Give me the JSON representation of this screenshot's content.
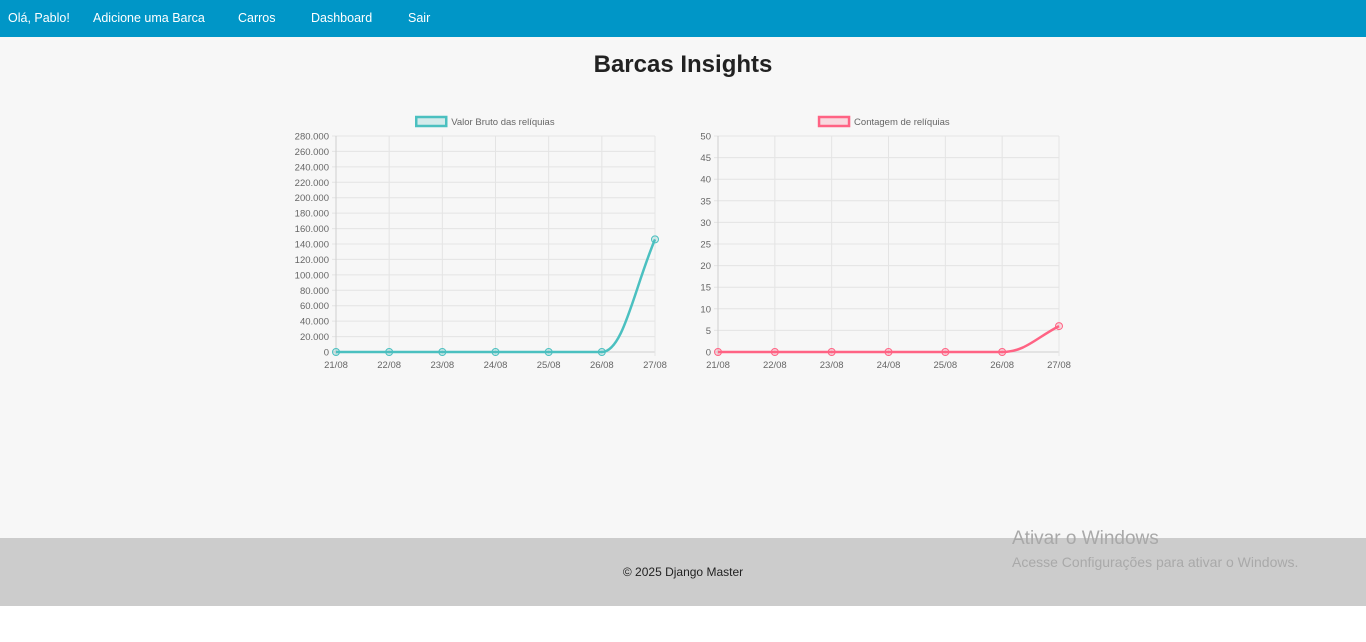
{
  "nav": {
    "greeting": "Olá, Pablo!",
    "links": [
      "Adicione uma Barca",
      "Carros",
      "Dashboard",
      "Sair"
    ]
  },
  "page": {
    "title": "Barcas Insights"
  },
  "chart_data": [
    {
      "type": "line",
      "categories": [
        "21/08",
        "22/08",
        "23/08",
        "24/08",
        "25/08",
        "26/08",
        "27/08"
      ],
      "series": [
        {
          "name": "Valor Bruto das relíquias",
          "values": [
            0,
            0,
            0,
            0,
            0,
            0,
            146000
          ],
          "color": "#4bc0c0"
        }
      ],
      "yticks": [
        "0",
        "20.000",
        "40.000",
        "60.000",
        "80.000",
        "100.000",
        "120.000",
        "140.000",
        "160.000",
        "180.000",
        "200.000",
        "220.000",
        "240.000",
        "260.000",
        "280.000"
      ],
      "ylim": [
        0,
        280000
      ],
      "grid": true,
      "legend": "top"
    },
    {
      "type": "line",
      "categories": [
        "21/08",
        "22/08",
        "23/08",
        "24/08",
        "25/08",
        "26/08",
        "27/08"
      ],
      "series": [
        {
          "name": "Contagem de relíquias",
          "values": [
            0,
            0,
            0,
            0,
            0,
            0,
            6
          ],
          "color": "#ff6384"
        }
      ],
      "yticks": [
        "0",
        "5",
        "10",
        "15",
        "20",
        "25",
        "30",
        "35",
        "40",
        "45",
        "50"
      ],
      "ylim": [
        0,
        50
      ],
      "grid": true,
      "legend": "top"
    }
  ],
  "footer": {
    "text": "© 2025 Django Master"
  },
  "watermark": {
    "title": "Ativar o Windows",
    "subtitle": "Acesse Configurações para ativar o Windows."
  }
}
